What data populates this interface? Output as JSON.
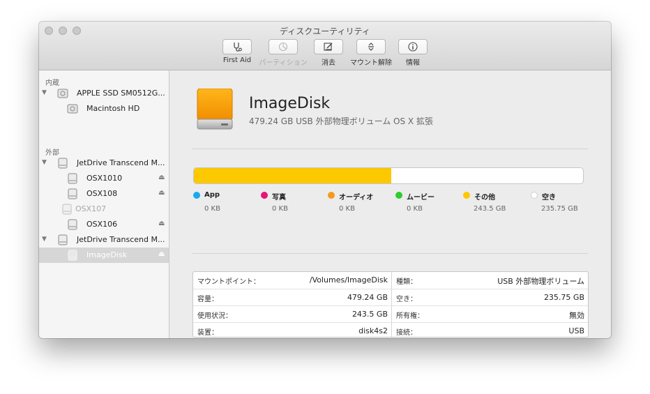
{
  "window": {
    "title": "ディスクユーティリティ"
  },
  "toolbar": {
    "first_aid": "First Aid",
    "partition": "パーティション",
    "erase": "消去",
    "unmount": "マウント解除",
    "info": "情報"
  },
  "sidebar": {
    "internal_header": "内蔵",
    "external_header": "外部",
    "items": [
      {
        "label": "APPLE SSD SM0512G..."
      },
      {
        "label": "Macintosh HD"
      },
      {
        "label": "JetDrive Transcend M..."
      },
      {
        "label": "OSX1010"
      },
      {
        "label": "OSX108"
      },
      {
        "label": "OSX107"
      },
      {
        "label": "OSX106"
      },
      {
        "label": "JetDrive Transcend M..."
      },
      {
        "label": "ImageDisk"
      }
    ]
  },
  "disk": {
    "name": "ImageDisk",
    "subtitle": "479.24 GB USB 外部物理ボリューム OS X 拡張"
  },
  "usage": {
    "used_fraction": 0.508,
    "fill_color": "#fcc800",
    "legend": [
      {
        "name": "App",
        "value": "0 KB",
        "color": "#1aa9f0"
      },
      {
        "name": "写真",
        "value": "0 KB",
        "color": "#e6157a"
      },
      {
        "name": "オーディオ",
        "value": "0 KB",
        "color": "#f59a1c"
      },
      {
        "name": "ムービー",
        "value": "0 KB",
        "color": "#2ecc2e"
      },
      {
        "name": "その他",
        "value": "243.5 GB",
        "color": "#fcc800"
      },
      {
        "name": "空き",
        "value": "235.75 GB",
        "color": "#ffffff"
      }
    ]
  },
  "info": {
    "left": [
      {
        "key": "マウントポイント：",
        "value": "/Volumes/ImageDisk"
      },
      {
        "key": "容量：",
        "value": "479.24 GB"
      },
      {
        "key": "使用状況：",
        "value": "243.5 GB"
      },
      {
        "key": "装置：",
        "value": "disk4s2"
      }
    ],
    "right": [
      {
        "key": "種類：",
        "value": "USB 外部物理ボリューム"
      },
      {
        "key": "空き：",
        "value": "235.75 GB"
      },
      {
        "key": "所有権：",
        "value": "無効"
      },
      {
        "key": "接続：",
        "value": "USB"
      }
    ]
  }
}
